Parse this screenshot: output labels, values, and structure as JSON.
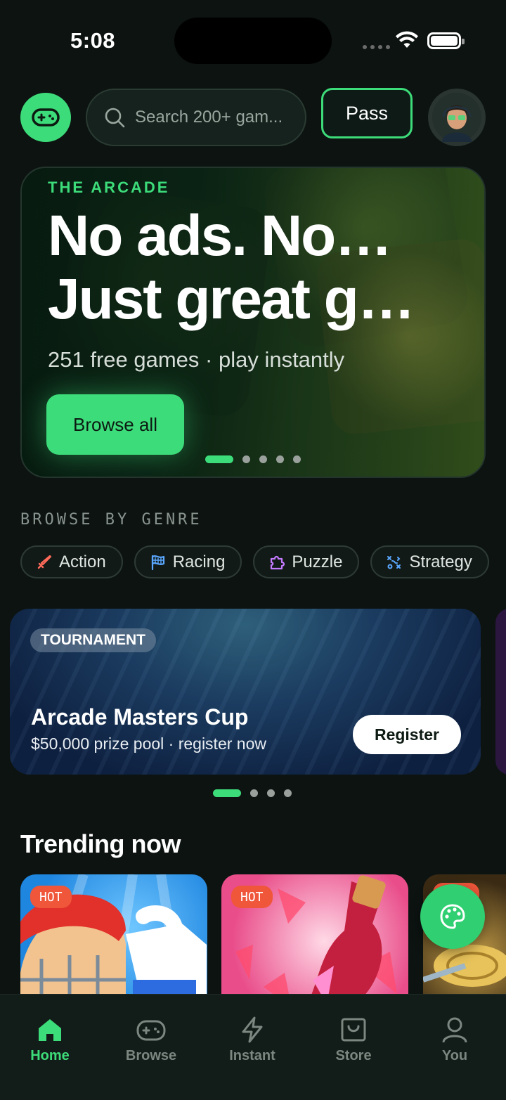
{
  "status_bar": {
    "time": "5:08"
  },
  "header": {
    "search_placeholder": "Search 200+ gam...",
    "pass_label": "Pass"
  },
  "hero": {
    "eyebrow": "THE ARCADE",
    "headline_line1": "No ads. No…",
    "headline_line2": "Just great g…",
    "subtitle": "251 free games · play instantly",
    "cta_label": "Browse all",
    "page_count": 5,
    "active_page": 1
  },
  "genre": {
    "section_label": "BROWSE BY GENRE",
    "chips": [
      {
        "label": "Action",
        "icon": "sword-icon"
      },
      {
        "label": "Racing",
        "icon": "flag-icon"
      },
      {
        "label": "Puzzle",
        "icon": "puzzle-icon"
      },
      {
        "label": "Strategy",
        "icon": "strategy-icon"
      }
    ]
  },
  "tournament": {
    "badge": "TOURNAMENT",
    "title": "Arcade Masters Cup",
    "subtitle": "$50,000 prize pool · register now",
    "cta_label": "Register",
    "page_count": 4,
    "active_page": 1
  },
  "trending": {
    "title": "Trending now",
    "cards": [
      {
        "badge": "HOT"
      },
      {
        "badge": "HOT"
      },
      {
        "badge": ""
      }
    ]
  },
  "tabbar": {
    "items": [
      {
        "label": "Home",
        "icon": "home-icon",
        "active": true
      },
      {
        "label": "Browse",
        "icon": "gamepad-icon",
        "active": false
      },
      {
        "label": "Instant",
        "icon": "lightning-icon",
        "active": false
      },
      {
        "label": "Store",
        "icon": "store-icon",
        "active": false
      },
      {
        "label": "You",
        "icon": "user-icon",
        "active": false
      }
    ]
  },
  "colors": {
    "accent": "#3ddc7a",
    "background": "#0c1311",
    "hot_badge": "#f0563a"
  }
}
